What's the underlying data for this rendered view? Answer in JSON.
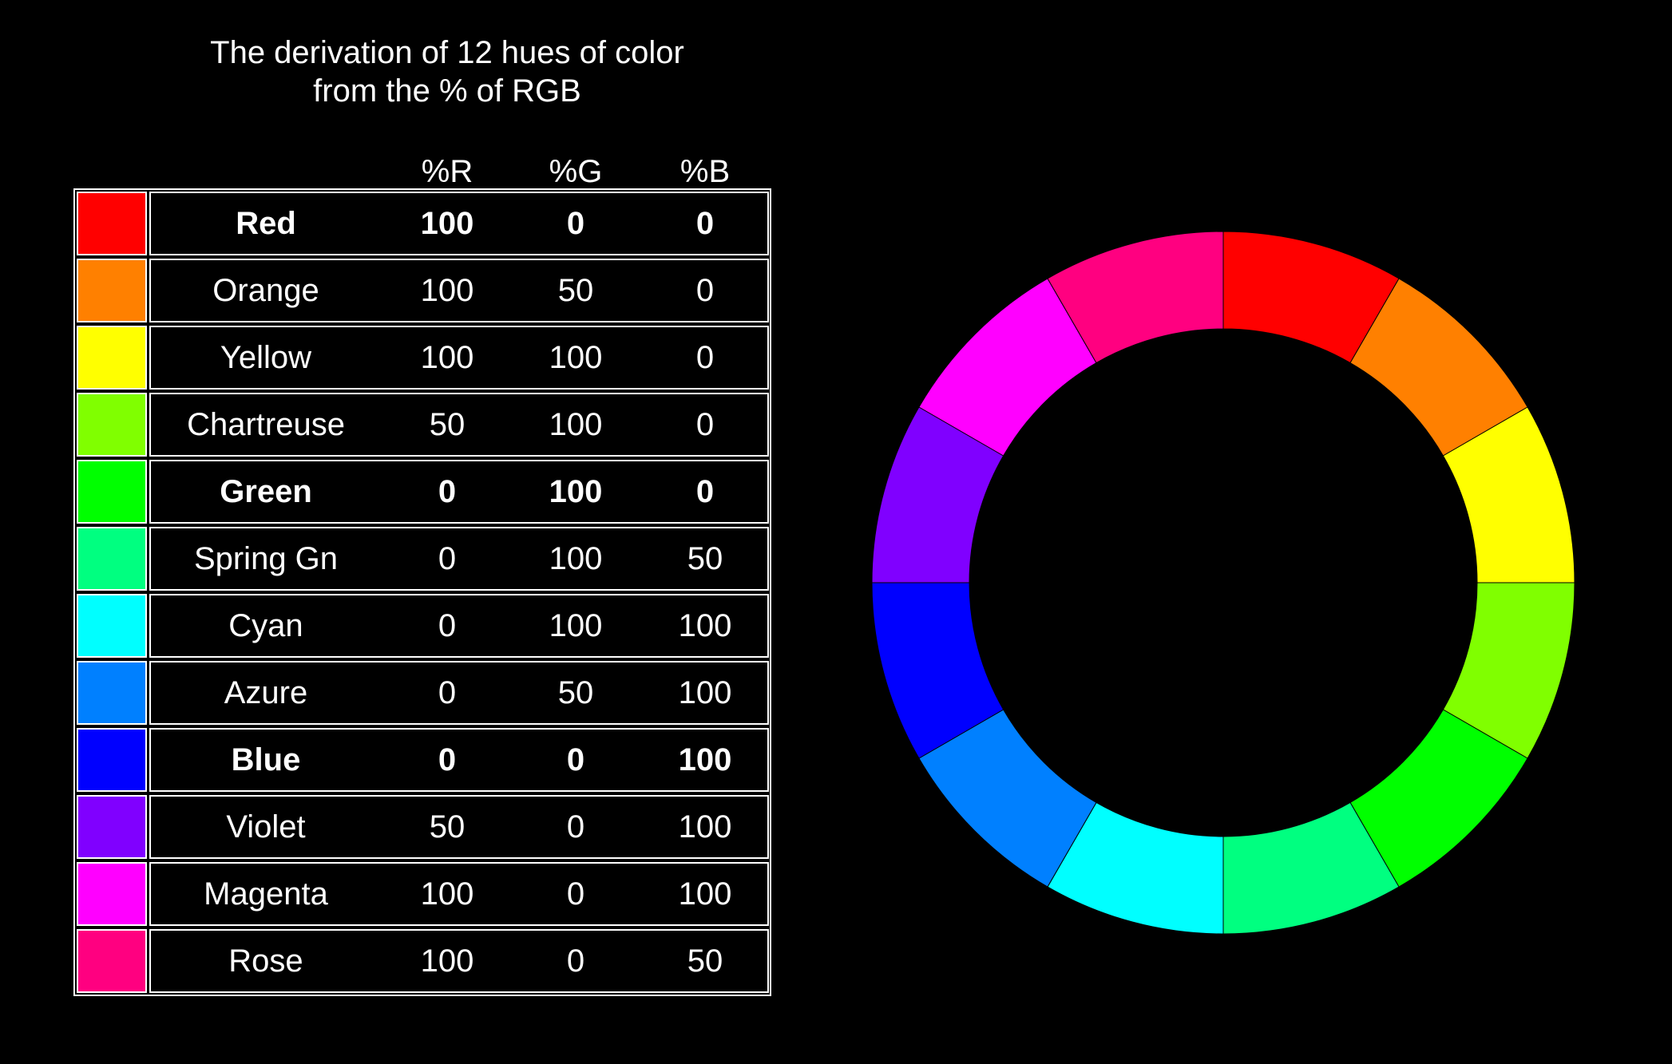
{
  "title": {
    "line1": "The derivation of 12 hues of color",
    "line2": "from the % of RGB"
  },
  "columns": {
    "r": "%R",
    "g": "%G",
    "b": "%B"
  },
  "rows": [
    {
      "name": "Red",
      "r": "100",
      "g": "0",
      "b": "0",
      "color": "#ff0000",
      "bold": true
    },
    {
      "name": "Orange",
      "r": "100",
      "g": "50",
      "b": "0",
      "color": "#ff8000",
      "bold": false
    },
    {
      "name": "Yellow",
      "r": "100",
      "g": "100",
      "b": "0",
      "color": "#ffff00",
      "bold": false
    },
    {
      "name": "Chartreuse",
      "r": "50",
      "g": "100",
      "b": "0",
      "color": "#80ff00",
      "bold": false
    },
    {
      "name": "Green",
      "r": "0",
      "g": "100",
      "b": "0",
      "color": "#00ff00",
      "bold": true
    },
    {
      "name": "Spring Gn",
      "r": "0",
      "g": "100",
      "b": "50",
      "color": "#00ff80",
      "bold": false
    },
    {
      "name": "Cyan",
      "r": "0",
      "g": "100",
      "b": "100",
      "color": "#00ffff",
      "bold": false
    },
    {
      "name": "Azure",
      "r": "0",
      "g": "50",
      "b": "100",
      "color": "#0080ff",
      "bold": false
    },
    {
      "name": "Blue",
      "r": "0",
      "g": "0",
      "b": "100",
      "color": "#0000ff",
      "bold": true
    },
    {
      "name": "Violet",
      "r": "50",
      "g": "0",
      "b": "100",
      "color": "#8000ff",
      "bold": false
    },
    {
      "name": "Magenta",
      "r": "100",
      "g": "0",
      "b": "100",
      "color": "#ff00ff",
      "bold": false
    },
    {
      "name": "Rose",
      "r": "100",
      "g": "0",
      "b": "50",
      "color": "#ff0080",
      "bold": false
    }
  ],
  "wheel_order": [
    "Red",
    "Orange",
    "Yellow",
    "Chartreuse",
    "Green",
    "Spring Gn",
    "Cyan",
    "Azure",
    "Blue",
    "Violet",
    "Magenta",
    "Rose"
  ]
}
